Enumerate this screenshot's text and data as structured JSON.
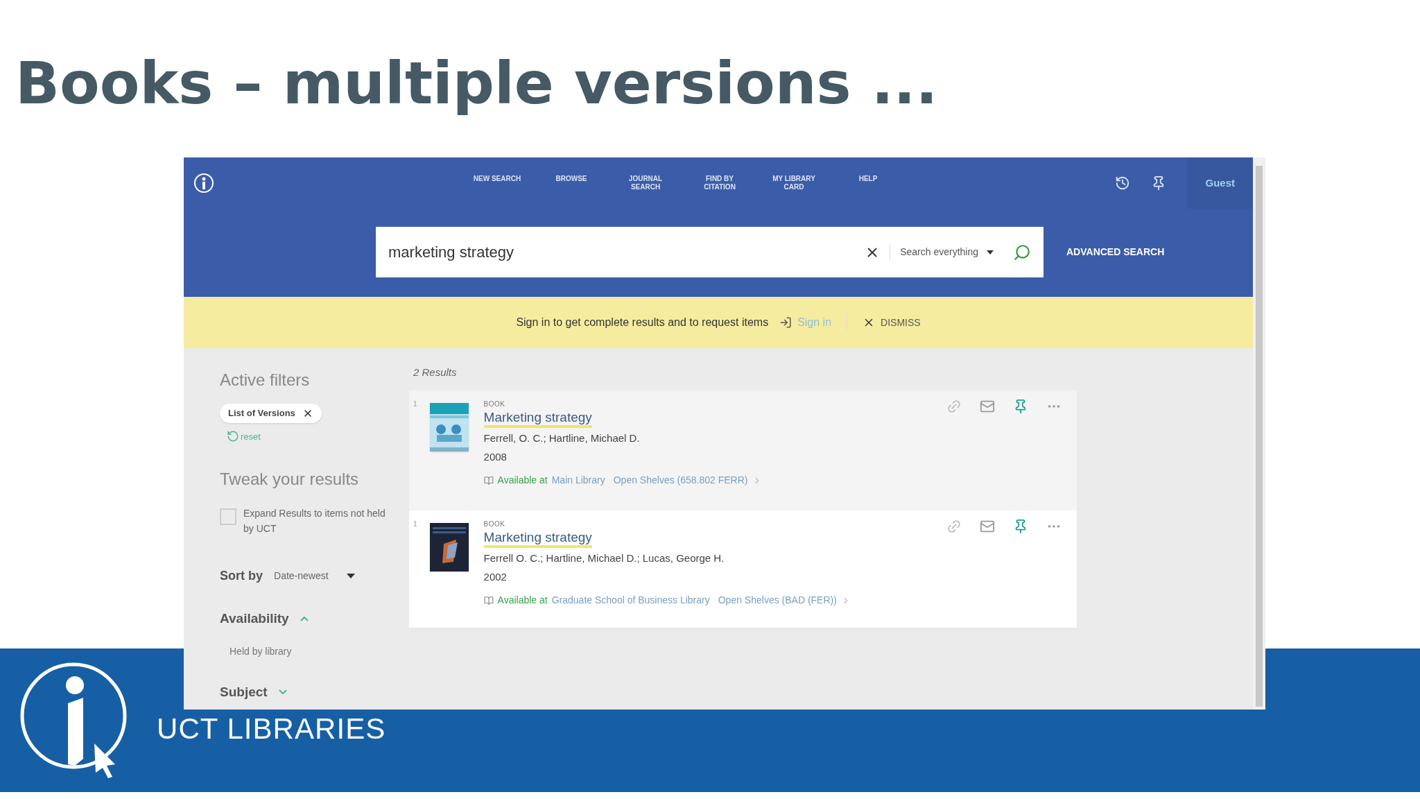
{
  "slide_title": "Books – multiple versions ...",
  "screenshot": {
    "nav": {
      "items": [
        "NEW SEARCH",
        "BROWSE",
        "JOURNAL SEARCH",
        "FIND BY CITATION",
        "MY LIBRARY CARD",
        "HELP"
      ],
      "user": "Guest"
    },
    "search": {
      "value": "marketing strategy",
      "scope": "Search everything",
      "advanced": "ADVANCED SEARCH"
    },
    "notice": {
      "text": "Sign in to get complete results and to request items",
      "sign_in": "Sign in",
      "dismiss": "DISMISS"
    },
    "sidebar": {
      "active_filters_title": "Active filters",
      "filters": [
        "List of Versions"
      ],
      "reset": "reset",
      "tweak_title": "Tweak your results",
      "expand": {
        "label": "Expand Results to items not held by UCT",
        "checked": false
      },
      "sort_label": "Sort by",
      "sort_value": "Date-newest",
      "facets": [
        {
          "label": "Availability",
          "expanded": true,
          "children": [
            "Held by library"
          ]
        },
        {
          "label": "Subject",
          "expanded": false
        }
      ]
    },
    "results_count": "2 Results",
    "results": [
      {
        "number": "1",
        "type": "BOOK",
        "title": "Marketing strategy",
        "authors": "Ferrell, O. C.; Hartline, Michael D.",
        "year": "2008",
        "availability": "Available at",
        "library": "Main Library",
        "location": "Open Shelves (658.802 FERR)",
        "highlighted": true
      },
      {
        "number": "1",
        "type": "BOOK",
        "title": "Marketing strategy",
        "authors": "Ferrell O. C.; Hartline, Michael D.; Lucas, George H.",
        "year": "2002",
        "availability": "Available at",
        "library": "Graduate School of Business Library",
        "location": "Open Shelves (BAD (FER))",
        "highlighted": false
      }
    ]
  },
  "footer": {
    "brand": "UCT LIBRARIES"
  }
}
